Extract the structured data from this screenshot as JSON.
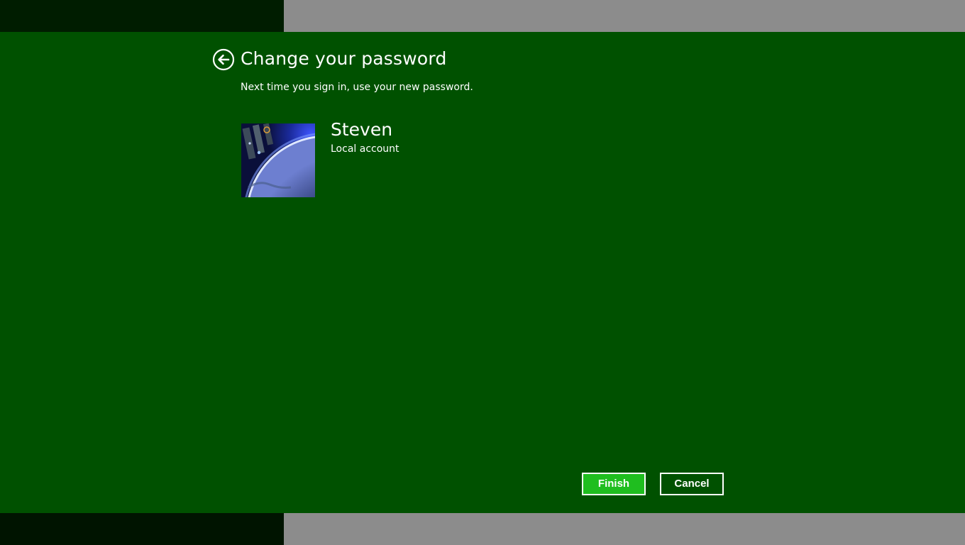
{
  "window": {
    "accent_color": "#005100",
    "finish_color": "#1fbe1f"
  },
  "header": {
    "back_icon": "back-arrow-circle-icon",
    "title": "Change your password",
    "subtitle": "Next time you sign in, use your new password."
  },
  "user": {
    "avatar_icon": "earth-space-avatar",
    "name": "Steven",
    "account_type": "Local account"
  },
  "actions": {
    "finish_label": "Finish",
    "cancel_label": "Cancel"
  }
}
